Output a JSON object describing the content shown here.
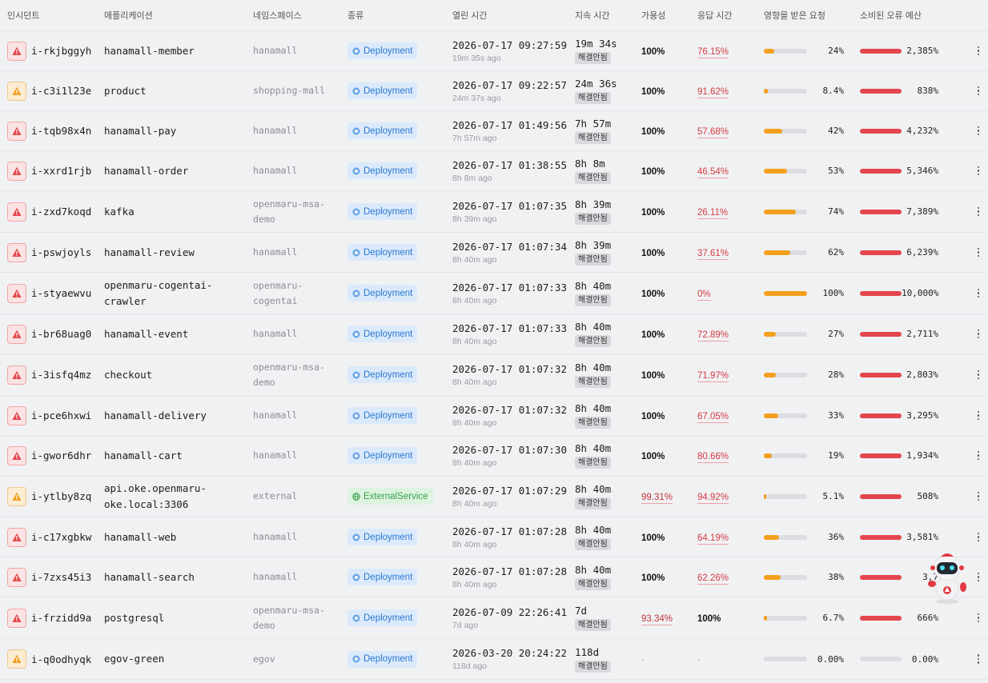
{
  "columns": {
    "incident": "인시던트",
    "application": "애플리케이션",
    "namespace": "네임스페이스",
    "kind": "종류",
    "opened": "열린 시간",
    "duration": "지속 시간",
    "availability": "가용성",
    "response": "응답 시간",
    "affected": "영향을 받은 요청",
    "budget": "소비된 오류 예산"
  },
  "colors": {
    "severity_critical": "#e3474d",
    "severity_warning": "#f0a020",
    "affected_bar": "#f4a01f",
    "budget_bar": "#e3474d",
    "deployment_badge": "#2b78d0",
    "external_badge": "#3aa14d"
  },
  "rows": [
    {
      "severity": "critical",
      "id": "i-rkjbggyh",
      "app": "hanamall-member",
      "ns": "hanamall",
      "kind": "Deployment",
      "opened": "2026-07-17 09:27:59",
      "ago": "19m 35s ago",
      "duration": "19m 34s",
      "status": "해결안됨",
      "availability": "100%",
      "response": "76.15%",
      "affected": "24%",
      "affected_ratio": 0.24,
      "budget": "2,385%",
      "budget_ratio": 1
    },
    {
      "severity": "warning",
      "id": "i-c3i1l23e",
      "app": "product",
      "ns": "shopping-mall",
      "kind": "Deployment",
      "opened": "2026-07-17 09:22:57",
      "ago": "24m 37s ago",
      "duration": "24m 36s",
      "status": "해결안됨",
      "availability": "100%",
      "response": "91.62%",
      "affected": "8.4%",
      "affected_ratio": 0.084,
      "budget": "838%",
      "budget_ratio": 1
    },
    {
      "severity": "critical",
      "id": "i-tqb98x4n",
      "app": "hanamall-pay",
      "ns": "hanamall",
      "kind": "Deployment",
      "opened": "2026-07-17 01:49:56",
      "ago": "7h 57m ago",
      "duration": "7h 57m",
      "status": "해결안됨",
      "availability": "100%",
      "response": "57.68%",
      "affected": "42%",
      "affected_ratio": 0.42,
      "budget": "4,232%",
      "budget_ratio": 1
    },
    {
      "severity": "critical",
      "id": "i-xxrd1rjb",
      "app": "hanamall-order",
      "ns": "hanamall",
      "kind": "Deployment",
      "opened": "2026-07-17 01:38:55",
      "ago": "8h 8m ago",
      "duration": "8h 8m",
      "status": "해결안됨",
      "availability": "100%",
      "response": "46.54%",
      "affected": "53%",
      "affected_ratio": 0.53,
      "budget": "5,346%",
      "budget_ratio": 1
    },
    {
      "severity": "critical",
      "id": "i-zxd7koqd",
      "app": "kafka",
      "ns": "openmaru-msa-demo",
      "kind": "Deployment",
      "opened": "2026-07-17 01:07:35",
      "ago": "8h 39m ago",
      "duration": "8h 39m",
      "status": "해결안됨",
      "availability": "100%",
      "response": "26.11%",
      "affected": "74%",
      "affected_ratio": 0.74,
      "budget": "7,389%",
      "budget_ratio": 1
    },
    {
      "severity": "critical",
      "id": "i-pswjoyls",
      "app": "hanamall-review",
      "ns": "hanamall",
      "kind": "Deployment",
      "opened": "2026-07-17 01:07:34",
      "ago": "8h 40m ago",
      "duration": "8h 39m",
      "status": "해결안됨",
      "availability": "100%",
      "response": "37.61%",
      "affected": "62%",
      "affected_ratio": 0.62,
      "budget": "6,239%",
      "budget_ratio": 1
    },
    {
      "severity": "critical",
      "id": "i-styaewvu",
      "app": "openmaru-cogentai-crawler",
      "ns": "openmaru-cogentai",
      "kind": "Deployment",
      "opened": "2026-07-17 01:07:33",
      "ago": "8h 40m ago",
      "duration": "8h 40m",
      "status": "해결안됨",
      "availability": "100%",
      "response": "0%",
      "affected": "100%",
      "affected_ratio": 1,
      "budget": "10,000%",
      "budget_ratio": 1
    },
    {
      "severity": "critical",
      "id": "i-br68uag0",
      "app": "hanamall-event",
      "ns": "hanamall",
      "kind": "Deployment",
      "opened": "2026-07-17 01:07:33",
      "ago": "8h 40m ago",
      "duration": "8h 40m",
      "status": "해결안됨",
      "availability": "100%",
      "response": "72.89%",
      "affected": "27%",
      "affected_ratio": 0.27,
      "budget": "2,711%",
      "budget_ratio": 1
    },
    {
      "severity": "critical",
      "id": "i-3isfq4mz",
      "app": "checkout",
      "ns": "openmaru-msa-demo",
      "kind": "Deployment",
      "opened": "2026-07-17 01:07:32",
      "ago": "8h 40m ago",
      "duration": "8h 40m",
      "status": "해결안됨",
      "availability": "100%",
      "response": "71.97%",
      "affected": "28%",
      "affected_ratio": 0.28,
      "budget": "2,803%",
      "budget_ratio": 1
    },
    {
      "severity": "critical",
      "id": "i-pce6hxwi",
      "app": "hanamall-delivery",
      "ns": "hanamall",
      "kind": "Deployment",
      "opened": "2026-07-17 01:07:32",
      "ago": "8h 40m ago",
      "duration": "8h 40m",
      "status": "해결안됨",
      "availability": "100%",
      "response": "67.05%",
      "affected": "33%",
      "affected_ratio": 0.33,
      "budget": "3,295%",
      "budget_ratio": 1
    },
    {
      "severity": "critical",
      "id": "i-gwor6dhr",
      "app": "hanamall-cart",
      "ns": "hanamall",
      "kind": "Deployment",
      "opened": "2026-07-17 01:07:30",
      "ago": "8h 40m ago",
      "duration": "8h 40m",
      "status": "해결안됨",
      "availability": "100%",
      "response": "80.66%",
      "affected": "19%",
      "affected_ratio": 0.19,
      "budget": "1,934%",
      "budget_ratio": 1
    },
    {
      "severity": "warning",
      "id": "i-ytlby8zq",
      "app": "api.oke.openmaru-oke.local:3306",
      "ns": "external",
      "kind": "ExternalService",
      "opened": "2026-07-17 01:07:29",
      "ago": "8h 40m ago",
      "duration": "8h 40m",
      "status": "해결안됨",
      "availability": "99.31%",
      "response": "94.92%",
      "affected": "5.1%",
      "affected_ratio": 0.051,
      "budget": "508%",
      "budget_ratio": 1
    },
    {
      "severity": "critical",
      "id": "i-c17xgbkw",
      "app": "hanamall-web",
      "ns": "hanamall",
      "kind": "Deployment",
      "opened": "2026-07-17 01:07:28",
      "ago": "8h 40m ago",
      "duration": "8h 40m",
      "status": "해결안됨",
      "availability": "100%",
      "response": "64.19%",
      "affected": "36%",
      "affected_ratio": 0.36,
      "budget": "3,581%",
      "budget_ratio": 1
    },
    {
      "severity": "critical",
      "id": "i-7zxs45i3",
      "app": "hanamall-search",
      "ns": "hanamall",
      "kind": "Deployment",
      "opened": "2026-07-17 01:07:28",
      "ago": "8h 40m ago",
      "duration": "8h 40m",
      "status": "해결안됨",
      "availability": "100%",
      "response": "62.26%",
      "affected": "38%",
      "affected_ratio": 0.38,
      "budget": "3,7",
      "budget_ratio": 1
    },
    {
      "severity": "critical",
      "id": "i-frzidd9a",
      "app": "postgresql",
      "ns": "openmaru-msa-demo",
      "kind": "Deployment",
      "opened": "2026-07-09 22:26:41",
      "ago": "7d ago",
      "duration": "7d",
      "status": "해결안됨",
      "availability": "93.34%",
      "response": "100%",
      "affected": "6.7%",
      "affected_ratio": 0.067,
      "budget": "666%",
      "budget_ratio": 1
    },
    {
      "severity": "warning",
      "id": "i-q0odhyqk",
      "app": "egov-green",
      "ns": "egov",
      "kind": "Deployment",
      "opened": "2026-03-20 20:24:22",
      "ago": "118d ago",
      "duration": "118d",
      "status": "해결안됨",
      "availability": "-",
      "response": "-",
      "affected": "0.00%",
      "affected_ratio": 0,
      "budget": "0.00%",
      "budget_ratio": 0
    }
  ]
}
